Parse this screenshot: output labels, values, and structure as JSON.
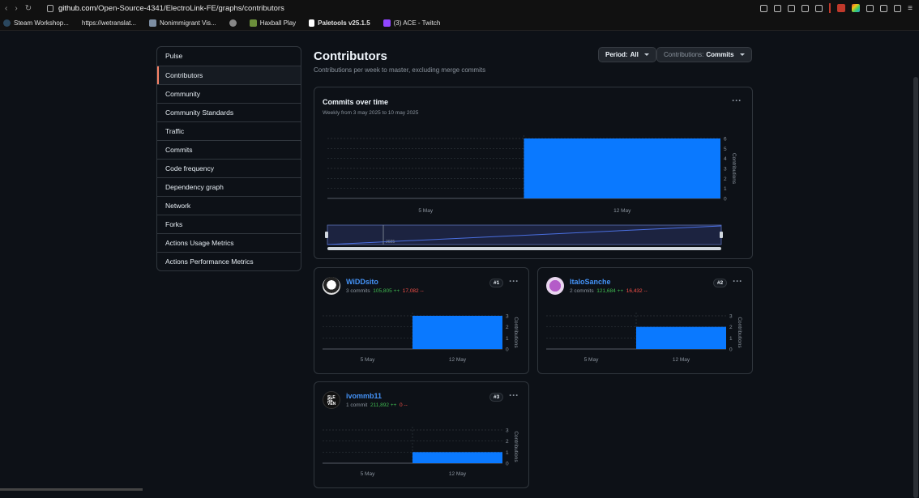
{
  "browser": {
    "url_host": "github.com",
    "url_path": "/Open-Source-4341/ElectroLink-FE/graphs/contributors",
    "bookmarks": [
      {
        "label": "Steam Workshop...",
        "color": "#2a475e"
      },
      {
        "label": "https://wetranslat...",
        "color": ""
      },
      {
        "label": "Nonimmigrant Vis...",
        "color": "#7d8ea3"
      },
      {
        "label": "",
        "color": "#888888"
      },
      {
        "label": "Haxball Play",
        "color": "#6b8e3a"
      },
      {
        "label": "Paletools v25.1.5",
        "color": "#ffffff"
      },
      {
        "label": "(3) ACE - Twitch",
        "color": "#9146ff"
      }
    ]
  },
  "sidenav": {
    "items": [
      {
        "label": "Pulse",
        "selected": false
      },
      {
        "label": "Contributors",
        "selected": true
      },
      {
        "label": "Community",
        "selected": false
      },
      {
        "label": "Community Standards",
        "selected": false
      },
      {
        "label": "Traffic",
        "selected": false
      },
      {
        "label": "Commits",
        "selected": false
      },
      {
        "label": "Code frequency",
        "selected": false
      },
      {
        "label": "Dependency graph",
        "selected": false
      },
      {
        "label": "Network",
        "selected": false
      },
      {
        "label": "Forks",
        "selected": false
      },
      {
        "label": "Actions Usage Metrics",
        "selected": false
      },
      {
        "label": "Actions Performance Metrics",
        "selected": false
      }
    ]
  },
  "header": {
    "title": "Contributors",
    "subtitle": "Contributions per week to master, excluding merge commits",
    "period_prefix": "Period:",
    "period_value": "All",
    "contrib_prefix": "Contributions:",
    "contrib_value": "Commits"
  },
  "main_chart": {
    "title": "Commits over time",
    "subtitle": "Weekly from 3 may 2025 to 10 may 2025",
    "brush_label": "2025"
  },
  "colors": {
    "bar": "#0a79ff",
    "accent": "#f78166",
    "link": "#4493f8",
    "add": "#3fb950",
    "del": "#f85149"
  },
  "chart_data": [
    {
      "type": "bar",
      "title": "Commits over time",
      "categories": [
        "5 May",
        "12 May"
      ],
      "values": [
        0,
        6
      ],
      "ylabel": "Contributions",
      "yticks": [
        "0",
        "1",
        "2",
        "3",
        "4",
        "5",
        "6"
      ],
      "ylim": [
        0,
        6
      ]
    },
    {
      "type": "bar",
      "title": "WiDDsito",
      "categories": [
        "5 May",
        "12 May"
      ],
      "values": [
        0,
        3
      ],
      "ylabel": "Contributions",
      "yticks": [
        "0",
        "1",
        "2",
        "3"
      ],
      "ylim": [
        0,
        3
      ]
    },
    {
      "type": "bar",
      "title": "ItaloSanche",
      "categories": [
        "5 May",
        "12 May"
      ],
      "values": [
        0,
        2
      ],
      "ylabel": "Contributions",
      "yticks": [
        "0",
        "1",
        "2",
        "3"
      ],
      "ylim": [
        0,
        3
      ]
    },
    {
      "type": "bar",
      "title": "ivommb11",
      "categories": [
        "5 May",
        "12 May"
      ],
      "values": [
        0,
        1
      ],
      "ylabel": "Contributions",
      "yticks": [
        "0",
        "1",
        "2",
        "3"
      ],
      "ylim": [
        0,
        3
      ]
    }
  ],
  "contributors": [
    {
      "name": "WiDDsito",
      "commits": "3 commits",
      "additions": "105,805 ++",
      "deletions": "17,082 --",
      "rank": "#1"
    },
    {
      "name": "ItaloSanche",
      "commits": "2 commits",
      "additions": "121,684 ++",
      "deletions": "16,432 --",
      "rank": "#2"
    },
    {
      "name": "ivommb11",
      "commits": "1 commit",
      "additions": "211,892 ++",
      "deletions": "0 --",
      "rank": "#3"
    }
  ]
}
